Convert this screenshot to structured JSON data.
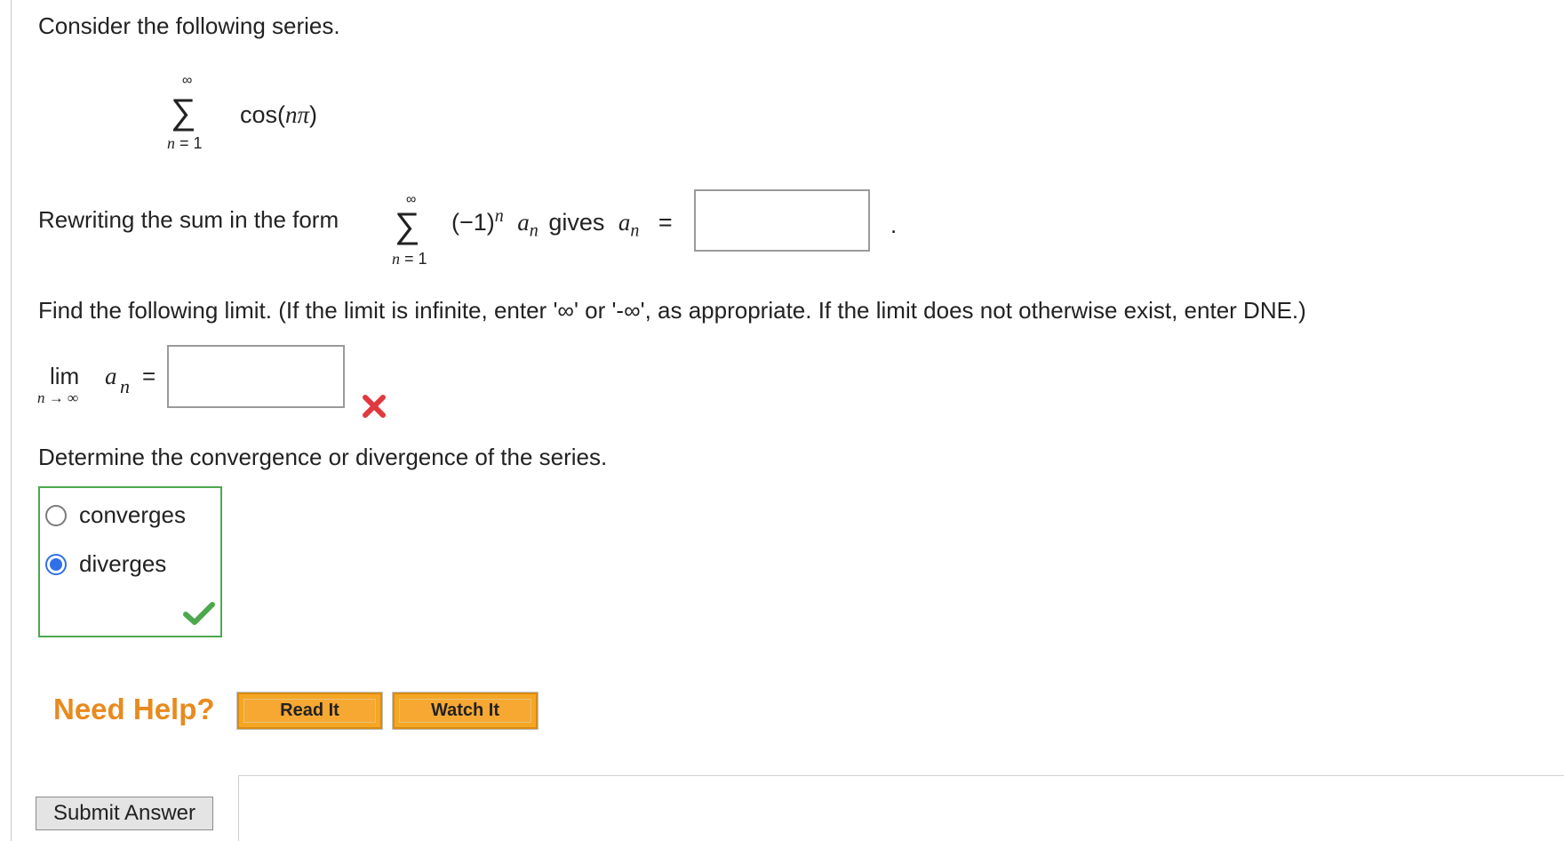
{
  "intro": "Consider the following series.",
  "series": {
    "upper": "∞",
    "sigma": "∑",
    "lower_var": "n",
    "lower_rest": " = 1",
    "term_cos": "cos(",
    "term_var": "nπ",
    "term_close": ")"
  },
  "rewrite": {
    "prefix": "Rewriting the sum in the form",
    "upper": "∞",
    "sigma": "∑",
    "lower_var": "n",
    "lower_rest": " = 1",
    "base": "(−1)",
    "exp": "n",
    "a": "a",
    "a_sub": "n",
    "gives": "gives",
    "eq": "=",
    "answer_value": "",
    "period": "."
  },
  "limit_instructions": "Find the following limit. (If the limit is infinite, enter '∞' or '-∞', as appropriate. If the limit does not otherwise exist, enter DNE.)",
  "limit": {
    "lim": "lim",
    "sub": "n → ∞",
    "a": "a",
    "a_sub": "n",
    "eq": "=",
    "answer_value": "",
    "status": "incorrect"
  },
  "determine": "Determine the convergence or divergence of the series.",
  "choices": [
    {
      "label": "converges",
      "selected": false
    },
    {
      "label": "diverges",
      "selected": true
    }
  ],
  "choices_status": "correct",
  "help": {
    "title": "Need Help?",
    "read_it": "Read It",
    "watch_it": "Watch It"
  },
  "submit": "Submit Answer",
  "colors": {
    "need_help": "#e98a1e",
    "help_button": "#f5a623",
    "correct": "#4da84d",
    "incorrect": "#e0393e",
    "radio_selected": "#2f6fe8"
  }
}
